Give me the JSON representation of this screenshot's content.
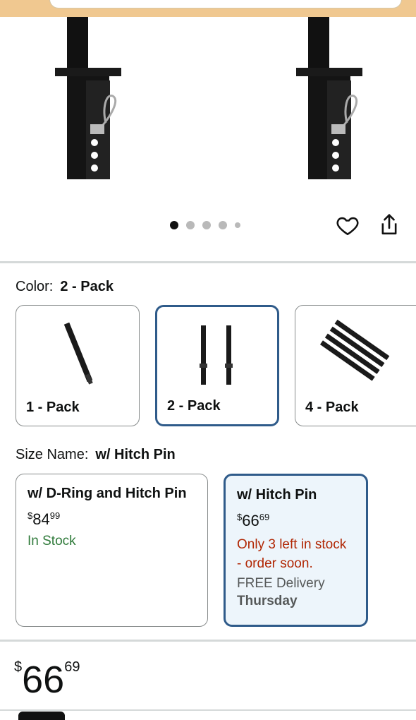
{
  "gallery": {
    "dot_count": 5,
    "active_dot": 0
  },
  "variations": {
    "color_label": "Color:",
    "color_value": "2 - Pack",
    "color_options": [
      {
        "label": "1 - Pack",
        "selected": false
      },
      {
        "label": "2 - Pack",
        "selected": true
      },
      {
        "label": "4 - Pack",
        "selected": false
      }
    ],
    "size_label": "Size Name:",
    "size_value": "w/ Hitch Pin",
    "size_options": [
      {
        "title": "w/ D-Ring and Hitch Pin",
        "price_currency": "$",
        "price_whole": "84",
        "price_fraction": "99",
        "stock": "In Stock",
        "selected": false
      },
      {
        "title": "w/ Hitch Pin",
        "price_currency": "$",
        "price_whole": "66",
        "price_fraction": "69",
        "stock_line1": "Only 3 left in stock",
        "stock_line2": "- order soon.",
        "delivery": "FREE Delivery",
        "delivery_day": "Thursday",
        "selected": true
      }
    ]
  },
  "price": {
    "currency": "$",
    "whole": "66",
    "fraction": "69"
  },
  "colors": {
    "selected_border": "#2f5b8a",
    "in_stock": "#2f7a3a",
    "low_stock": "#b12704"
  }
}
